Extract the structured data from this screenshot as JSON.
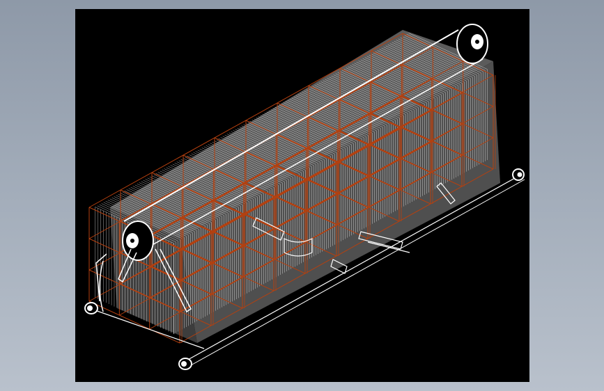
{
  "viewport": {
    "background_color": "#000000",
    "frame_color": "#b5400f",
    "body_color": "#5b5b5b",
    "tube_color": "#ffffff",
    "page_background_color": "#9aa5b3",
    "drawing": "boiler-wireframe"
  }
}
